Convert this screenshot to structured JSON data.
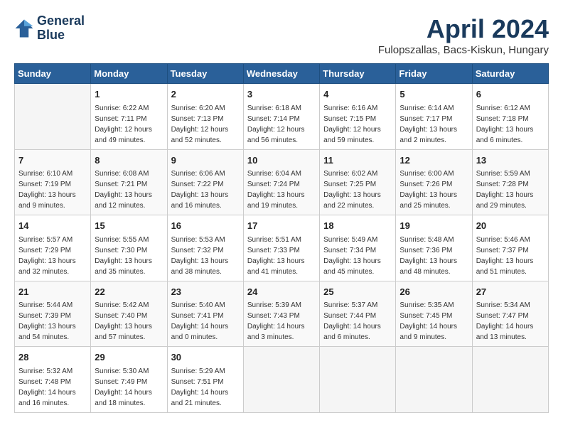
{
  "logo": {
    "line1": "General",
    "line2": "Blue"
  },
  "title": "April 2024",
  "location": "Fulopszallas, Bacs-Kiskun, Hungary",
  "weekdays": [
    "Sunday",
    "Monday",
    "Tuesday",
    "Wednesday",
    "Thursday",
    "Friday",
    "Saturday"
  ],
  "weeks": [
    [
      {
        "day": "",
        "sunrise": "",
        "sunset": "",
        "daylight": ""
      },
      {
        "day": "1",
        "sunrise": "Sunrise: 6:22 AM",
        "sunset": "Sunset: 7:11 PM",
        "daylight": "Daylight: 12 hours and 49 minutes."
      },
      {
        "day": "2",
        "sunrise": "Sunrise: 6:20 AM",
        "sunset": "Sunset: 7:13 PM",
        "daylight": "Daylight: 12 hours and 52 minutes."
      },
      {
        "day": "3",
        "sunrise": "Sunrise: 6:18 AM",
        "sunset": "Sunset: 7:14 PM",
        "daylight": "Daylight: 12 hours and 56 minutes."
      },
      {
        "day": "4",
        "sunrise": "Sunrise: 6:16 AM",
        "sunset": "Sunset: 7:15 PM",
        "daylight": "Daylight: 12 hours and 59 minutes."
      },
      {
        "day": "5",
        "sunrise": "Sunrise: 6:14 AM",
        "sunset": "Sunset: 7:17 PM",
        "daylight": "Daylight: 13 hours and 2 minutes."
      },
      {
        "day": "6",
        "sunrise": "Sunrise: 6:12 AM",
        "sunset": "Sunset: 7:18 PM",
        "daylight": "Daylight: 13 hours and 6 minutes."
      }
    ],
    [
      {
        "day": "7",
        "sunrise": "Sunrise: 6:10 AM",
        "sunset": "Sunset: 7:19 PM",
        "daylight": "Daylight: 13 hours and 9 minutes."
      },
      {
        "day": "8",
        "sunrise": "Sunrise: 6:08 AM",
        "sunset": "Sunset: 7:21 PM",
        "daylight": "Daylight: 13 hours and 12 minutes."
      },
      {
        "day": "9",
        "sunrise": "Sunrise: 6:06 AM",
        "sunset": "Sunset: 7:22 PM",
        "daylight": "Daylight: 13 hours and 16 minutes."
      },
      {
        "day": "10",
        "sunrise": "Sunrise: 6:04 AM",
        "sunset": "Sunset: 7:24 PM",
        "daylight": "Daylight: 13 hours and 19 minutes."
      },
      {
        "day": "11",
        "sunrise": "Sunrise: 6:02 AM",
        "sunset": "Sunset: 7:25 PM",
        "daylight": "Daylight: 13 hours and 22 minutes."
      },
      {
        "day": "12",
        "sunrise": "Sunrise: 6:00 AM",
        "sunset": "Sunset: 7:26 PM",
        "daylight": "Daylight: 13 hours and 25 minutes."
      },
      {
        "day": "13",
        "sunrise": "Sunrise: 5:59 AM",
        "sunset": "Sunset: 7:28 PM",
        "daylight": "Daylight: 13 hours and 29 minutes."
      }
    ],
    [
      {
        "day": "14",
        "sunrise": "Sunrise: 5:57 AM",
        "sunset": "Sunset: 7:29 PM",
        "daylight": "Daylight: 13 hours and 32 minutes."
      },
      {
        "day": "15",
        "sunrise": "Sunrise: 5:55 AM",
        "sunset": "Sunset: 7:30 PM",
        "daylight": "Daylight: 13 hours and 35 minutes."
      },
      {
        "day": "16",
        "sunrise": "Sunrise: 5:53 AM",
        "sunset": "Sunset: 7:32 PM",
        "daylight": "Daylight: 13 hours and 38 minutes."
      },
      {
        "day": "17",
        "sunrise": "Sunrise: 5:51 AM",
        "sunset": "Sunset: 7:33 PM",
        "daylight": "Daylight: 13 hours and 41 minutes."
      },
      {
        "day": "18",
        "sunrise": "Sunrise: 5:49 AM",
        "sunset": "Sunset: 7:34 PM",
        "daylight": "Daylight: 13 hours and 45 minutes."
      },
      {
        "day": "19",
        "sunrise": "Sunrise: 5:48 AM",
        "sunset": "Sunset: 7:36 PM",
        "daylight": "Daylight: 13 hours and 48 minutes."
      },
      {
        "day": "20",
        "sunrise": "Sunrise: 5:46 AM",
        "sunset": "Sunset: 7:37 PM",
        "daylight": "Daylight: 13 hours and 51 minutes."
      }
    ],
    [
      {
        "day": "21",
        "sunrise": "Sunrise: 5:44 AM",
        "sunset": "Sunset: 7:39 PM",
        "daylight": "Daylight: 13 hours and 54 minutes."
      },
      {
        "day": "22",
        "sunrise": "Sunrise: 5:42 AM",
        "sunset": "Sunset: 7:40 PM",
        "daylight": "Daylight: 13 hours and 57 minutes."
      },
      {
        "day": "23",
        "sunrise": "Sunrise: 5:40 AM",
        "sunset": "Sunset: 7:41 PM",
        "daylight": "Daylight: 14 hours and 0 minutes."
      },
      {
        "day": "24",
        "sunrise": "Sunrise: 5:39 AM",
        "sunset": "Sunset: 7:43 PM",
        "daylight": "Daylight: 14 hours and 3 minutes."
      },
      {
        "day": "25",
        "sunrise": "Sunrise: 5:37 AM",
        "sunset": "Sunset: 7:44 PM",
        "daylight": "Daylight: 14 hours and 6 minutes."
      },
      {
        "day": "26",
        "sunrise": "Sunrise: 5:35 AM",
        "sunset": "Sunset: 7:45 PM",
        "daylight": "Daylight: 14 hours and 9 minutes."
      },
      {
        "day": "27",
        "sunrise": "Sunrise: 5:34 AM",
        "sunset": "Sunset: 7:47 PM",
        "daylight": "Daylight: 14 hours and 13 minutes."
      }
    ],
    [
      {
        "day": "28",
        "sunrise": "Sunrise: 5:32 AM",
        "sunset": "Sunset: 7:48 PM",
        "daylight": "Daylight: 14 hours and 16 minutes."
      },
      {
        "day": "29",
        "sunrise": "Sunrise: 5:30 AM",
        "sunset": "Sunset: 7:49 PM",
        "daylight": "Daylight: 14 hours and 18 minutes."
      },
      {
        "day": "30",
        "sunrise": "Sunrise: 5:29 AM",
        "sunset": "Sunset: 7:51 PM",
        "daylight": "Daylight: 14 hours and 21 minutes."
      },
      {
        "day": "",
        "sunrise": "",
        "sunset": "",
        "daylight": ""
      },
      {
        "day": "",
        "sunrise": "",
        "sunset": "",
        "daylight": ""
      },
      {
        "day": "",
        "sunrise": "",
        "sunset": "",
        "daylight": ""
      },
      {
        "day": "",
        "sunrise": "",
        "sunset": "",
        "daylight": ""
      }
    ]
  ]
}
